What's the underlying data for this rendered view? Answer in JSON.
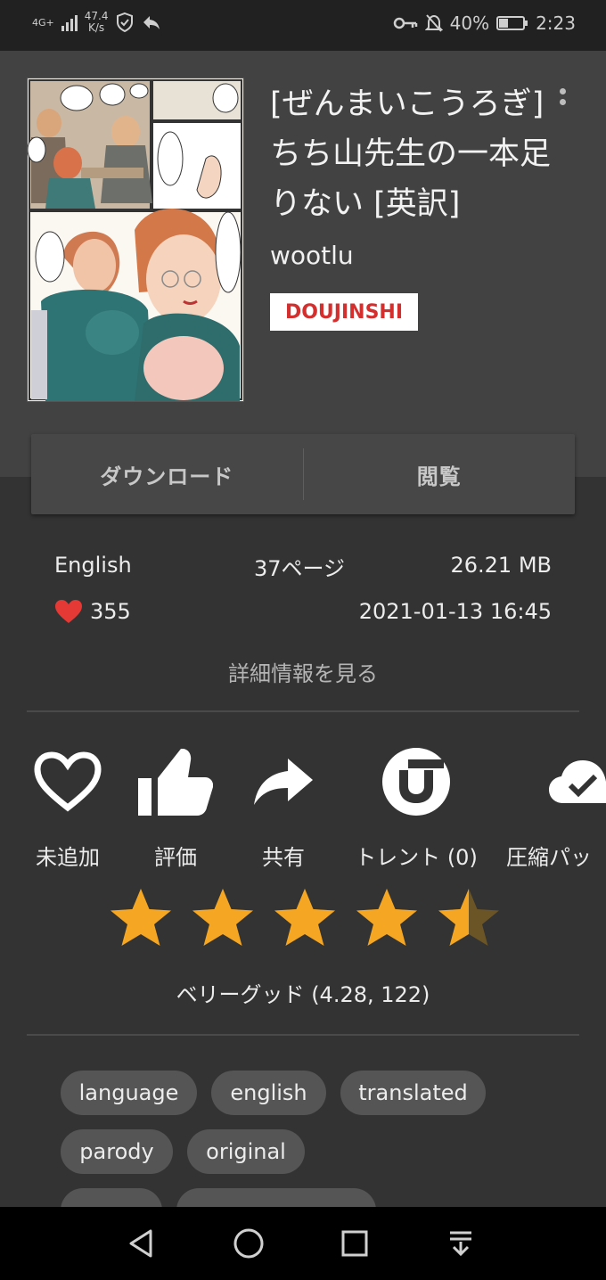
{
  "status_bar": {
    "network": "4G+",
    "speed_value": "47.4",
    "speed_unit": "K/s",
    "battery_percent": "40%",
    "battery_level": 0.4,
    "time": "2:23"
  },
  "gallery": {
    "title": "[ぜんまいこうろぎ] ちち山先生の一本足りない [英訳]",
    "artist": "wootlu",
    "category": "DOUJINSHI",
    "category_color": "#d32f2f"
  },
  "buttons": {
    "download": "ダウンロード",
    "read": "閲覧"
  },
  "info": {
    "language": "English",
    "pages": "37ページ",
    "size": "26.21 MB",
    "favorites": "355",
    "posted": "2021-01-13 16:45",
    "more": "詳細情報を見る"
  },
  "actions": [
    {
      "label": "未追加",
      "icon": "heart-outline-icon"
    },
    {
      "label": "評価",
      "icon": "thumbs-up-icon"
    },
    {
      "label": "共有",
      "icon": "share-arrow-icon"
    },
    {
      "label": "トレント (0)",
      "icon": "torrent-icon"
    },
    {
      "label": "圧縮パッ",
      "icon": "cloud-check-icon"
    }
  ],
  "rating": {
    "stars": 4.5,
    "text": "ベリーグッド (4.28, 122)",
    "star_color": "#f5a623"
  },
  "tags": [
    "language",
    "english",
    "translated",
    "parody",
    "original"
  ]
}
